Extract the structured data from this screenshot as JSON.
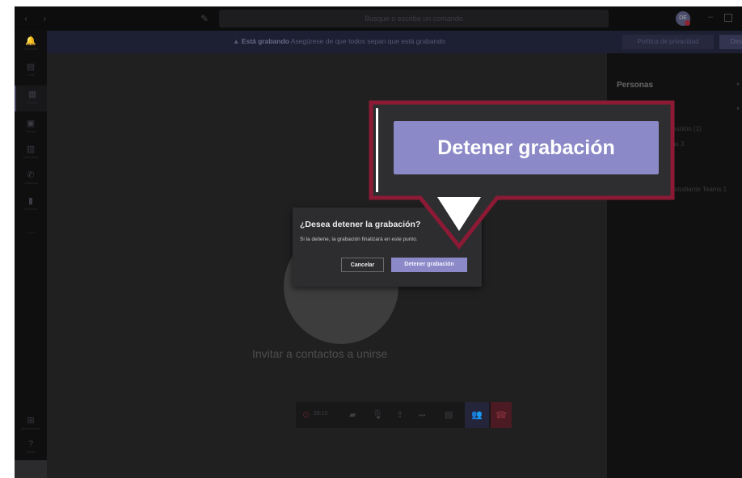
{
  "titlebar": {
    "nav_arrows": "‹ ›",
    "compose_icon": "compose-icon",
    "search_placeholder": "Busque o escriba un comando",
    "avatar_initials": "DE",
    "minimize_glyph": "–"
  },
  "rail": {
    "items": [
      {
        "icon": "bell-icon",
        "glyph": "🔔",
        "label": "Actividad"
      },
      {
        "icon": "chat-icon",
        "glyph": "▤",
        "label": "Chat"
      },
      {
        "icon": "teams-icon",
        "glyph": "▦",
        "label": "Equipos"
      },
      {
        "icon": "assignments-icon",
        "glyph": "▣",
        "label": "Tareas"
      },
      {
        "icon": "calendar-icon",
        "glyph": "▥",
        "label": "Calendario"
      },
      {
        "icon": "calls-icon",
        "glyph": "✆",
        "label": "Llamadas"
      },
      {
        "icon": "files-icon",
        "glyph": "▮",
        "label": "Archivos"
      },
      {
        "icon": "more-icon",
        "glyph": "···",
        "label": ""
      }
    ],
    "apps": {
      "icon": "apps-icon",
      "glyph": "⊞",
      "label": "Aplicaciones"
    },
    "help": {
      "icon": "help-icon",
      "glyph": "?",
      "label": "Ayuda"
    }
  },
  "banner": {
    "warning_icon": "warning-icon",
    "warning_glyph": "▲",
    "bold": "Está grabando",
    "text": "Asegúrese de que todos sepan que está grabando",
    "privacy_button": "Política de privacidad",
    "discard_button": "Descartar"
  },
  "stage": {
    "invite_text": "Invitar a contactos a unirse"
  },
  "controls": {
    "timer_glyph": "⊙",
    "timer": "26:10",
    "video_glyph": "▰",
    "mic_glyph": "🎙",
    "share_glyph": "⇪",
    "more_glyph": "•••",
    "chat_glyph": "▤",
    "people_glyph": "👥",
    "hangup_glyph": "☎"
  },
  "panel": {
    "title": "Personas",
    "line1": "reunión (1)",
    "line2": "ms 3",
    "line3": "Estudiante Teams 1"
  },
  "dialog": {
    "title": "¿Desea detener la grabación?",
    "description": "Si la detiene, la grabación finalizará en este punto.",
    "cancel": "Cancelar",
    "confirm": "Detener grabación"
  },
  "callout": {
    "label": "Detener grabación",
    "border_color": "#8c1a35",
    "button_color": "#8b89c7"
  }
}
